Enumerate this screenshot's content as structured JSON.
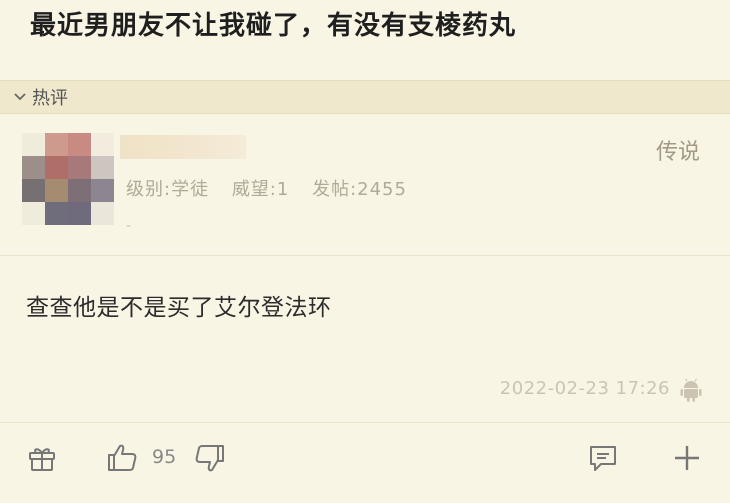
{
  "post": {
    "title": "最近男朋友不让我碰了，有没有支棱药丸"
  },
  "section": {
    "label": "热评"
  },
  "comment": {
    "rank": "传说",
    "level": "级别:学徒",
    "prestige": "威望:1",
    "posts": "发帖:2455",
    "signature": "-",
    "text": "查查他是不是买了艾尔登法环",
    "timestamp": "2022-02-23 17:26",
    "likes": "95"
  },
  "icons": {
    "gift": "gift-icon",
    "like": "thumbs-up-icon",
    "dislike": "thumbs-down-icon",
    "reply": "comment-icon",
    "more": "plus-icon",
    "device": "android-icon",
    "collapse": "chevron-down-icon"
  }
}
